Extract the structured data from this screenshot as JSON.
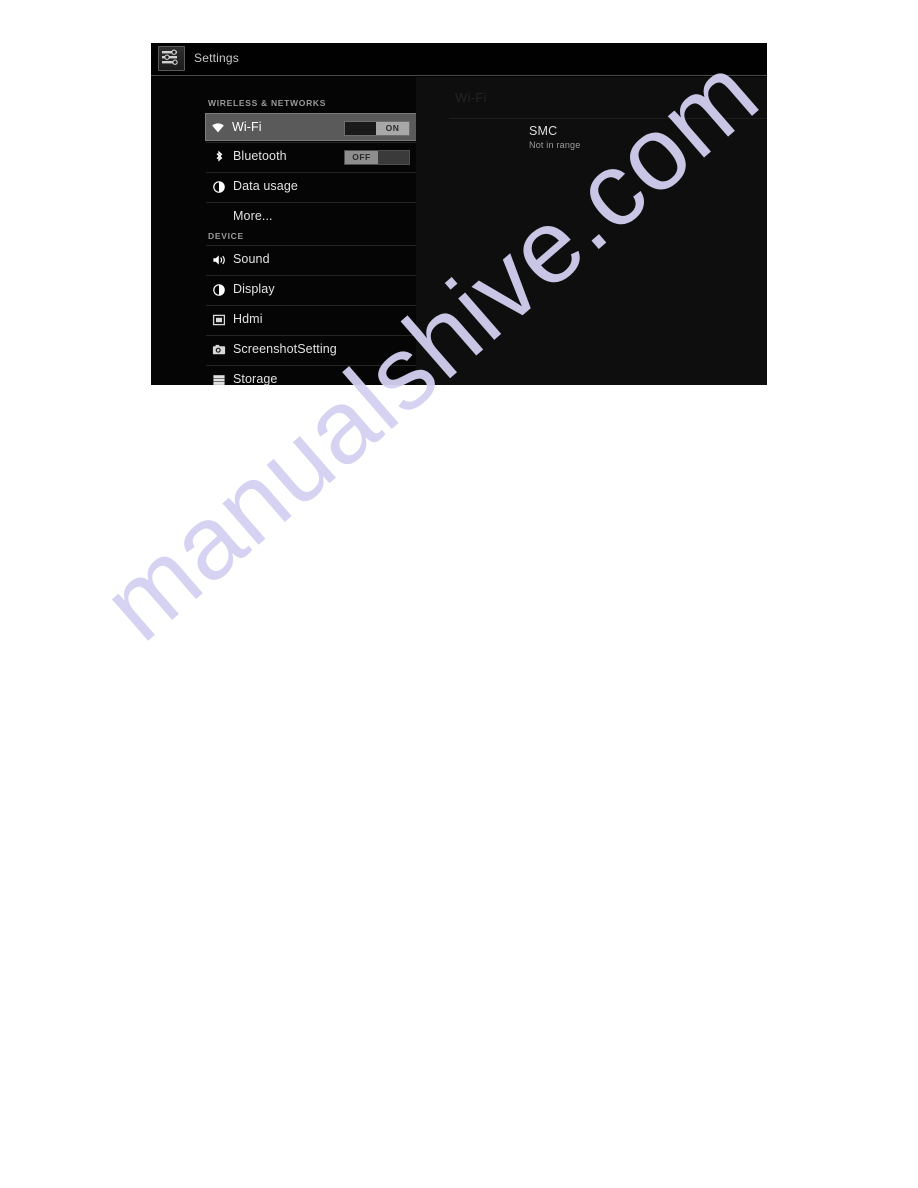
{
  "window": {
    "app_title": "Settings",
    "app_icon": "settings-sliders-icon"
  },
  "sidebar": {
    "sections": [
      {
        "header": "WIRELESS & NETWORKS",
        "items": [
          {
            "label": "Wi-Fi",
            "icon": "wifi-icon",
            "selected": true,
            "toggle": "ON"
          },
          {
            "label": "Bluetooth",
            "icon": "bluetooth-icon",
            "selected": false,
            "toggle": "OFF"
          },
          {
            "label": "Data usage",
            "icon": "data-usage-icon",
            "selected": false,
            "toggle": null
          },
          {
            "label": "More...",
            "icon": null,
            "selected": false,
            "toggle": null
          }
        ]
      },
      {
        "header": "DEVICE",
        "items": [
          {
            "label": "Sound",
            "icon": "sound-icon",
            "selected": false,
            "toggle": null
          },
          {
            "label": "Display",
            "icon": "display-icon",
            "selected": false,
            "toggle": null
          },
          {
            "label": "Hdmi",
            "icon": "hdmi-icon",
            "selected": false,
            "toggle": null
          },
          {
            "label": "ScreenshotSetting",
            "icon": "screenshot-icon",
            "selected": false,
            "toggle": null
          },
          {
            "label": "Storage",
            "icon": "storage-icon",
            "selected": false,
            "toggle": null
          }
        ]
      }
    ]
  },
  "detail": {
    "title": "Wi-Fi",
    "networks": [
      {
        "ssid": "SMC",
        "status": "Not in range"
      }
    ]
  },
  "watermark": {
    "text": "manualshive.com",
    "color": "#d3d0f2"
  },
  "colors": {
    "background": "#000000",
    "selected_row": "#5a5a5a",
    "toggle_thumb": "#a8a8a8",
    "page": "#ffffff"
  }
}
